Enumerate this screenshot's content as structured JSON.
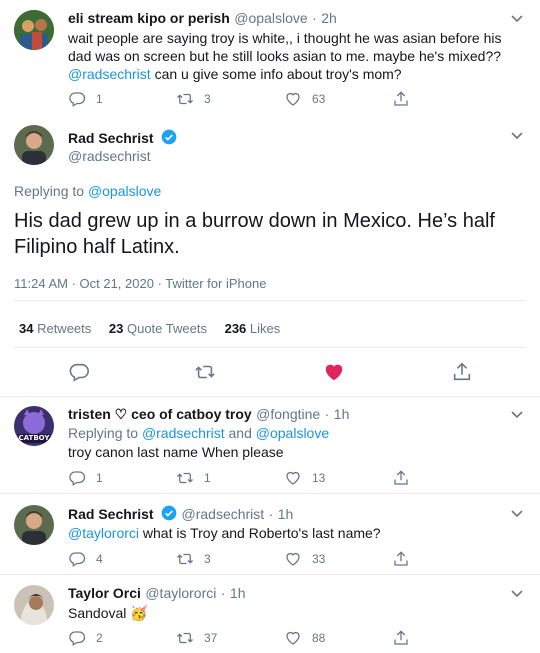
{
  "tweet1": {
    "name": "eli stream kipo or perish",
    "handle": "@opalslove",
    "sep": "·",
    "time": "2h",
    "text_before": "wait people are saying troy is white,, i thought he was asian before his dad was on screen but he still looks asian to me. maybe he's mixed??",
    "mention": "@radsechrist",
    "text_after": " can u give some info about troy's mom?",
    "replies": "1",
    "retweets": "3",
    "likes": "63"
  },
  "main": {
    "name": "Rad Sechrist",
    "handle": "@radsechrist",
    "replying_label": "Replying to ",
    "replying_to": "@opalslove",
    "text": "His dad grew up in a burrow down in Mexico.  He’s half Filipino half Latinx.",
    "timestamp": "11:24 AM · Oct 21, 2020 · Twitter for iPhone",
    "retweets_count": "34",
    "retweets_label": " Retweets",
    "quotes_count": "23",
    "quotes_label": " Quote Tweets",
    "likes_count": "236",
    "likes_label": " Likes"
  },
  "reply1": {
    "name": "tristen ♡ ceo of catboy troy",
    "handle": "@fongtine",
    "sep": "·",
    "time": "1h",
    "avatar_text": "CATBOY",
    "replying_label": "Replying to ",
    "mention1": "@radsechrist",
    "and": " and ",
    "mention2": "@opalslove",
    "text": "troy canon last name When please",
    "replies": "1",
    "retweets": "1",
    "likes": "13"
  },
  "reply2": {
    "name": "Rad Sechrist",
    "handle": "@radsechrist",
    "sep": "·",
    "time": "1h",
    "mention": "@taylororci",
    "text": " what is Troy and Roberto's last name?",
    "replies": "4",
    "retweets": "3",
    "likes": "33"
  },
  "reply3": {
    "name": "Taylor Orci",
    "handle": "@taylororci",
    "sep": "·",
    "time": "1h",
    "text": "Sandoval",
    "emoji": "🥳",
    "replies": "2",
    "retweets": "37",
    "likes": "88"
  },
  "colors": {
    "link": "#1b95e0",
    "muted": "#657786",
    "like_active": "#e0245e",
    "verified": "#1da1f2"
  }
}
